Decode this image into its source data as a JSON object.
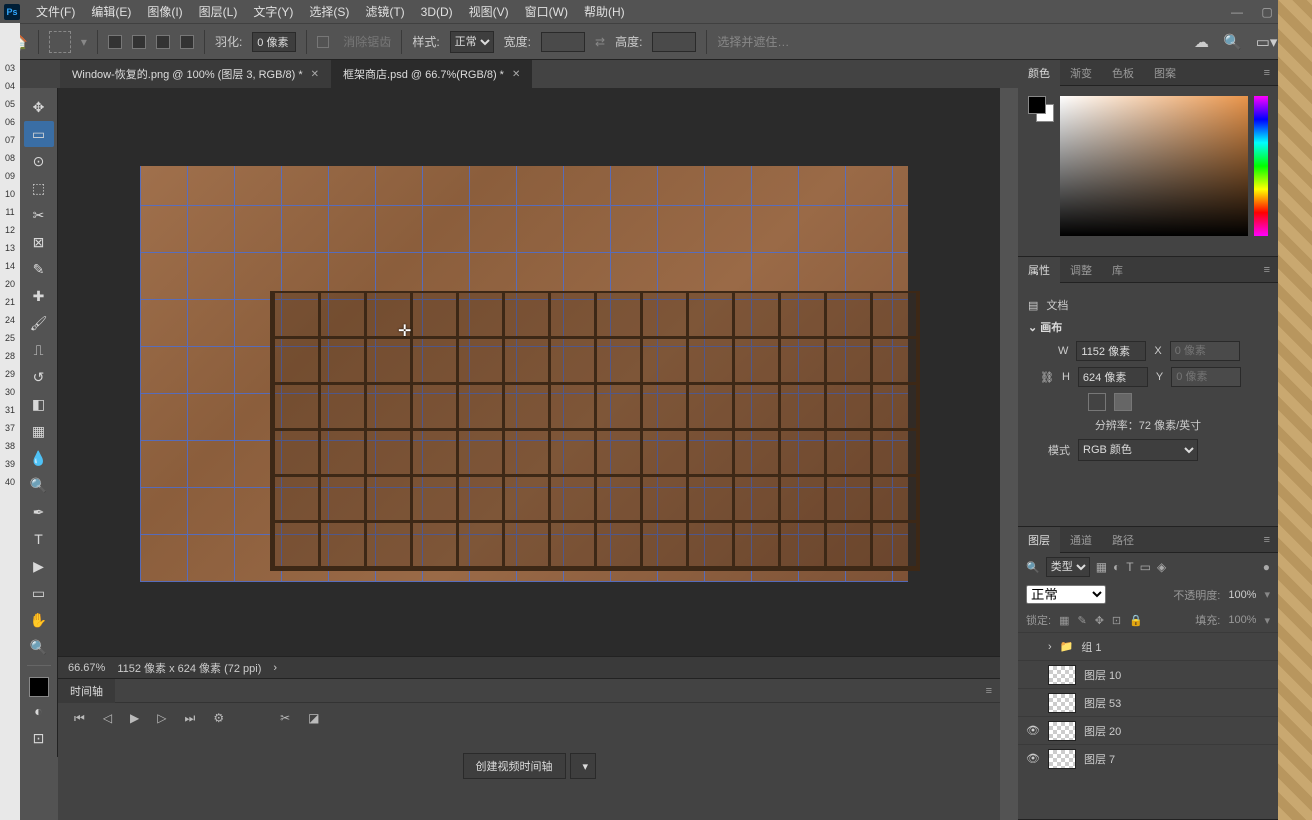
{
  "menubar": {
    "logo": "Ps",
    "items": [
      "文件(F)",
      "编辑(E)",
      "图像(I)",
      "图层(L)",
      "文字(Y)",
      "选择(S)",
      "滤镜(T)",
      "3D(D)",
      "视图(V)",
      "窗口(W)",
      "帮助(H)"
    ]
  },
  "optionsbar": {
    "feather_label": "羽化:",
    "feather_value": "0 像素",
    "antialias": "消除锯齿",
    "style_label": "样式:",
    "style_value": "正常",
    "width_label": "宽度:",
    "height_label": "高度:",
    "select_mask": "选择并遮住…"
  },
  "tabs": [
    {
      "label": "Window-恢复的.png @ 100% (图层 3, RGB/8) *",
      "active": false
    },
    {
      "label": "框架商店.psd @ 66.7%(RGB/8) *",
      "active": true
    }
  ],
  "status": {
    "zoom": "66.67%",
    "dims": "1152 像素 x 624 像素 (72 ppi)"
  },
  "timeline": {
    "title": "时间轴",
    "create_btn": "创建视频时间轴"
  },
  "colorPanel": {
    "tabs": [
      "颜色",
      "渐变",
      "色板",
      "图案"
    ]
  },
  "propsPanel": {
    "tabs": [
      "属性",
      "调整",
      "库"
    ],
    "doc_label": "文档",
    "canvas_label": "画布",
    "w": "W",
    "w_val": "1152 像素",
    "h": "H",
    "h_val": "624 像素",
    "x": "X",
    "x_ph": "0 像素",
    "y": "Y",
    "y_ph": "0 像素",
    "res": "分辨率：72 像素/英寸",
    "mode_label": "模式",
    "mode_val": "RGB 颜色"
  },
  "layersPanel": {
    "tabs": [
      "图层",
      "通道",
      "路径"
    ],
    "kind": "类型",
    "blend": "正常",
    "opacity_label": "不透明度:",
    "opacity": "100%",
    "lock_label": "锁定:",
    "fill_label": "填充:",
    "fill": "100%",
    "layers": [
      {
        "name": "组 1",
        "folder": true,
        "visible": false
      },
      {
        "name": "图层 10",
        "visible": false
      },
      {
        "name": "图层 53",
        "visible": false
      },
      {
        "name": "图层 20",
        "visible": true
      },
      {
        "name": "图层 7",
        "visible": true
      }
    ]
  },
  "os_left_nums": [
    "03",
    "04",
    "05",
    "06",
    "07",
    "08",
    "09",
    "10",
    "11",
    "12",
    "13",
    "14",
    "20",
    "21",
    "24",
    "25",
    "28",
    "29",
    "30",
    "31",
    "37",
    "38",
    "39",
    "40"
  ]
}
